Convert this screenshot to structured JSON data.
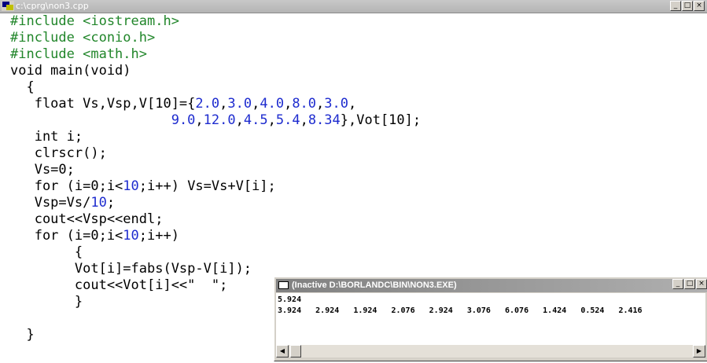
{
  "window": {
    "title": "c:\\cprg\\non3.cpp",
    "buttons": {
      "minimize": "_",
      "maximize": "□",
      "close": "×"
    }
  },
  "code_lines": [
    {
      "segments": [
        {
          "t": "#include <iostream.h>",
          "c": "pre"
        }
      ]
    },
    {
      "segments": [
        {
          "t": "#include <conio.h>",
          "c": "pre"
        }
      ]
    },
    {
      "segments": [
        {
          "t": "#include <math.h>",
          "c": "pre"
        }
      ]
    },
    {
      "segments": [
        {
          "t": "void main(void)",
          "c": "n"
        }
      ]
    },
    {
      "segments": [
        {
          "t": "  {",
          "c": "n"
        }
      ]
    },
    {
      "segments": [
        {
          "t": "   float Vs,Vsp,V[10]={",
          "c": "n"
        },
        {
          "t": "2.0",
          "c": "num"
        },
        {
          "t": ",",
          "c": "n"
        },
        {
          "t": "3.0",
          "c": "num"
        },
        {
          "t": ",",
          "c": "n"
        },
        {
          "t": "4.0",
          "c": "num"
        },
        {
          "t": ",",
          "c": "n"
        },
        {
          "t": "8.0",
          "c": "num"
        },
        {
          "t": ",",
          "c": "n"
        },
        {
          "t": "3.0",
          "c": "num"
        },
        {
          "t": ",",
          "c": "n"
        }
      ]
    },
    {
      "segments": [
        {
          "t": "                    ",
          "c": "n"
        },
        {
          "t": "9.0",
          "c": "num"
        },
        {
          "t": ",",
          "c": "n"
        },
        {
          "t": "12.0",
          "c": "num"
        },
        {
          "t": ",",
          "c": "n"
        },
        {
          "t": "4.5",
          "c": "num"
        },
        {
          "t": ",",
          "c": "n"
        },
        {
          "t": "5.4",
          "c": "num"
        },
        {
          "t": ",",
          "c": "n"
        },
        {
          "t": "8.34",
          "c": "num"
        },
        {
          "t": "},Vot[10];",
          "c": "n"
        }
      ]
    },
    {
      "segments": [
        {
          "t": "   int i;",
          "c": "n"
        }
      ]
    },
    {
      "segments": [
        {
          "t": "   clrscr();",
          "c": "n"
        }
      ]
    },
    {
      "segments": [
        {
          "t": "   Vs=0;",
          "c": "n"
        }
      ]
    },
    {
      "segments": [
        {
          "t": "   for (i=0;i<",
          "c": "n"
        },
        {
          "t": "10",
          "c": "num"
        },
        {
          "t": ";i++) Vs=Vs+V[i];",
          "c": "n"
        }
      ]
    },
    {
      "segments": [
        {
          "t": "   Vsp=Vs/",
          "c": "n"
        },
        {
          "t": "10",
          "c": "num"
        },
        {
          "t": ";",
          "c": "n"
        }
      ]
    },
    {
      "segments": [
        {
          "t": "   cout<<Vsp<<endl;",
          "c": "n"
        }
      ]
    },
    {
      "segments": [
        {
          "t": "   for (i=0;i<",
          "c": "n"
        },
        {
          "t": "10",
          "c": "num"
        },
        {
          "t": ";i++)",
          "c": "n"
        }
      ]
    },
    {
      "segments": [
        {
          "t": "        {",
          "c": "n"
        }
      ]
    },
    {
      "segments": [
        {
          "t": "        Vot[i]=fabs(Vsp-V[i]);",
          "c": "n"
        }
      ]
    },
    {
      "segments": [
        {
          "t": "        cout<<Vot[i]<<\"  \";",
          "c": "n"
        }
      ]
    },
    {
      "segments": [
        {
          "t": "        }",
          "c": "n"
        }
      ]
    },
    {
      "segments": [
        {
          "t": "",
          "c": "n"
        }
      ]
    },
    {
      "segments": [
        {
          "t": "  }",
          "c": "n"
        }
      ]
    }
  ],
  "console": {
    "title": "(Inactive D:\\BORLANDC\\BIN\\NON3.EXE)",
    "buttons": {
      "minimize": "_",
      "maximize": "□",
      "close": "×"
    },
    "output_lines": [
      "5.924",
      "3.924   2.924   1.924   2.076   2.924   3.076   6.076   1.424   0.524   2.416"
    ],
    "scroll_left": "◀",
    "scroll_right": "▶"
  },
  "colors": {
    "preprocessor": "#21862a",
    "number": "#1e2ccf",
    "text": "#000000"
  }
}
